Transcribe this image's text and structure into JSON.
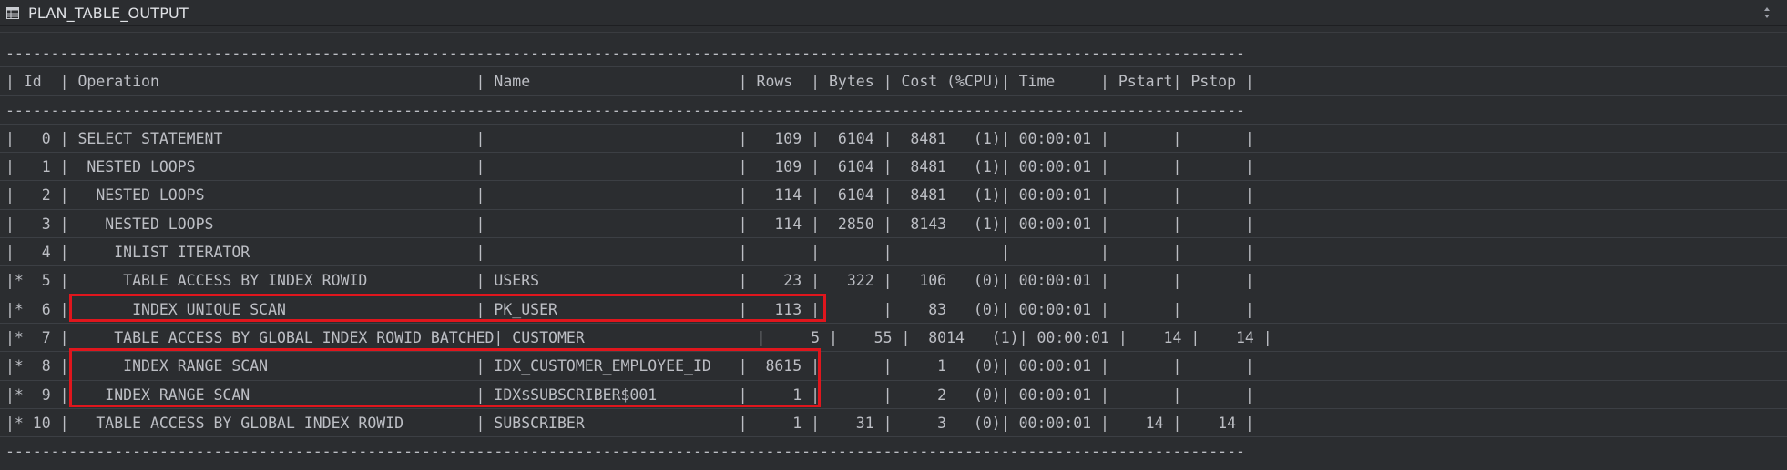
{
  "header": {
    "title": "PLAN_TABLE_OUTPUT",
    "table_icon": "table-icon",
    "sort_icon": "sort-updown-icon"
  },
  "plan_lines": [
    "-----------------------------------------------------------------------------------------------------------------------------------------",
    "| Id  | Operation                                   | Name                       | Rows  | Bytes | Cost (%CPU)| Time     | Pstart| Pstop |",
    "-----------------------------------------------------------------------------------------------------------------------------------------",
    "|   0 | SELECT STATEMENT                            |                            |   109 |  6104 |  8481   (1)| 00:00:01 |       |       |",
    "|   1 |  NESTED LOOPS                               |                            |   109 |  6104 |  8481   (1)| 00:00:01 |       |       |",
    "|   2 |   NESTED LOOPS                              |                            |   114 |  6104 |  8481   (1)| 00:00:01 |       |       |",
    "|   3 |    NESTED LOOPS                             |                            |   114 |  2850 |  8143   (1)| 00:00:01 |       |       |",
    "|   4 |     INLIST ITERATOR                         |                            |       |       |            |          |       |       |",
    "|*  5 |      TABLE ACCESS BY INDEX ROWID            | USERS                      |    23 |   322 |   106   (0)| 00:00:01 |       |       |",
    "|*  6 |       INDEX UNIQUE SCAN                     | PK_USER                    |   113 |       |    83   (0)| 00:00:01 |       |       |",
    "|*  7 |     TABLE ACCESS BY GLOBAL INDEX ROWID BATCHED| CUSTOMER                   |     5 |    55 |  8014   (1)| 00:00:01 |    14 |    14 |",
    "|*  8 |      INDEX RANGE SCAN                       | IDX_CUSTOMER_EMPLOYEE_ID   |  8615 |       |     1   (0)| 00:00:01 |       |       |",
    "|*  9 |    INDEX RANGE SCAN                         | IDX$SUBSCRIBER$001         |     1 |       |     2   (0)| 00:00:01 |       |       |",
    "|* 10 |   TABLE ACCESS BY GLOBAL INDEX ROWID        | SUBSCRIBER                 |     1 |    31 |     3   (0)| 00:00:01 |    14 |    14 |",
    "-----------------------------------------------------------------------------------------------------------------------------------------"
  ],
  "colors": {
    "background": "#2b2d30",
    "text": "#bcbec4",
    "highlight": "#e0161d",
    "grid": "#3c3f44"
  }
}
